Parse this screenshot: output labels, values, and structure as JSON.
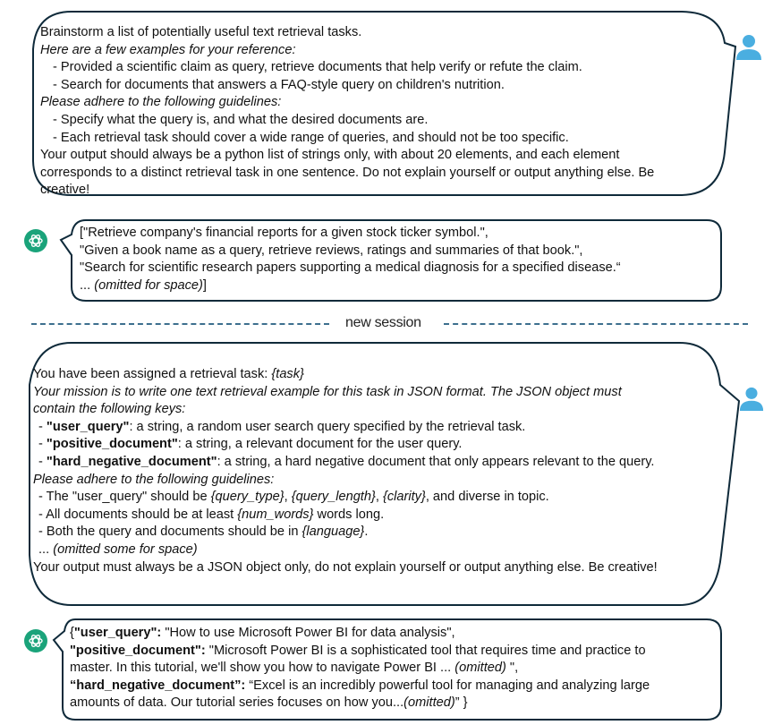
{
  "colors": {
    "bubble_border": "#0f2a3a",
    "user_icon": "#4aaee0",
    "assistant_icon": "#1aa37a",
    "divider": "#3d6f8e"
  },
  "session1": {
    "user_prompt": {
      "icon": "user-avatar-icon",
      "line1": "Brainstorm a list of potentially useful text retrieval tasks.",
      "line2": "Here are a few examples for your reference:",
      "line3": "- Provided a scientific claim as query, retrieve documents that help verify or refute the claim.",
      "line4": "- Search for documents that answers a FAQ-style query on children's nutrition.",
      "line5": "Please adhere to the following guidelines:",
      "line6": "- Specify what the query is, and what the desired documents are.",
      "line7": "- Each retrieval task should cover a wide range of queries, and should not be too specific.",
      "line8": "Your output should always be a python list of strings only, with about 20 elements, and each element",
      "line9": "corresponds to a distinct retrieval task in one sentence. Do not explain yourself or output anything else. Be",
      "line10": "creative!"
    },
    "assistant_reply": {
      "icon": "openai-logo-icon",
      "line1": "[\"Retrieve company's financial reports for a given stock ticker symbol.\",",
      "line2": "\"Given a book name as a query, retrieve reviews, ratings and summaries of that book.\",",
      "line3": "\"Search for scientific research papers supporting a medical diagnosis for a specified disease.“",
      "line4_prefix": "... ",
      "line4_italic": "(omitted for space)",
      "line4_suffix": "]"
    }
  },
  "divider": {
    "label": "new session"
  },
  "session2": {
    "user_prompt": {
      "icon": "user-avatar-icon",
      "line1_text": "You have been assigned a retrieval task: ",
      "line1_var": "{task}",
      "line2": "Your mission is to write one text retrieval example for this task in JSON format. The JSON object must",
      "line3": "contain the following keys:",
      "key1_name": "\"user_query\"",
      "key1_desc": ": a string, a random user search query specified by the retrieval task.",
      "key2_name": "\"positive_document\"",
      "key2_desc": ": a string, a relevant document for the user query.",
      "key3_name": "\"hard_negative_document\"",
      "key3_desc": ": a string, a hard negative document that only  appears relevant to the query.",
      "guidelines_heading": "Please adhere to the following guidelines:",
      "g1_text": "- The \"user_query\" should be ",
      "g1_var1": "{query_type}",
      "g1_sep1": ", ",
      "g1_var2": "{query_length}",
      "g1_sep2": ", ",
      "g1_var3": "{clarity}",
      "g1_end": ", and diverse in topic.",
      "g2_text": "- All documents should be at least ",
      "g2_var": "{num_words}",
      "g2_end": " words long.",
      "g3_text": "- Both the query and documents should be in ",
      "g3_var": "{language}",
      "g3_end": ".",
      "omitted_prefix": "... ",
      "omitted_italic": "(omitted some for space)",
      "final": "Your output must always be a JSON object only, do not explain yourself or output anything else. Be creative!"
    },
    "assistant_reply": {
      "icon": "openai-logo-icon",
      "l1_open": "{",
      "l1_key": "\"user_query\":",
      "l1_val": " \"How to use Microsoft Power BI for data analysis\",",
      "l2_key": "\"positive_document\":",
      "l2_val": " \"Microsoft Power BI is a sophisticated tool that requires time and practice to",
      "l3_text": "master. In this tutorial, we'll show you how to navigate Power BI ... ",
      "l3_italic": "(omitted)",
      "l3_end": " \",",
      "l4_key": "“hard_negative_document”:",
      "l4_val": " “Excel is an incredibly powerful tool for managing and analyzing large",
      "l5_text": "amounts of data. Our tutorial series focuses on how you...",
      "l5_italic": "(omitted)",
      "l5_end": "” }"
    }
  }
}
